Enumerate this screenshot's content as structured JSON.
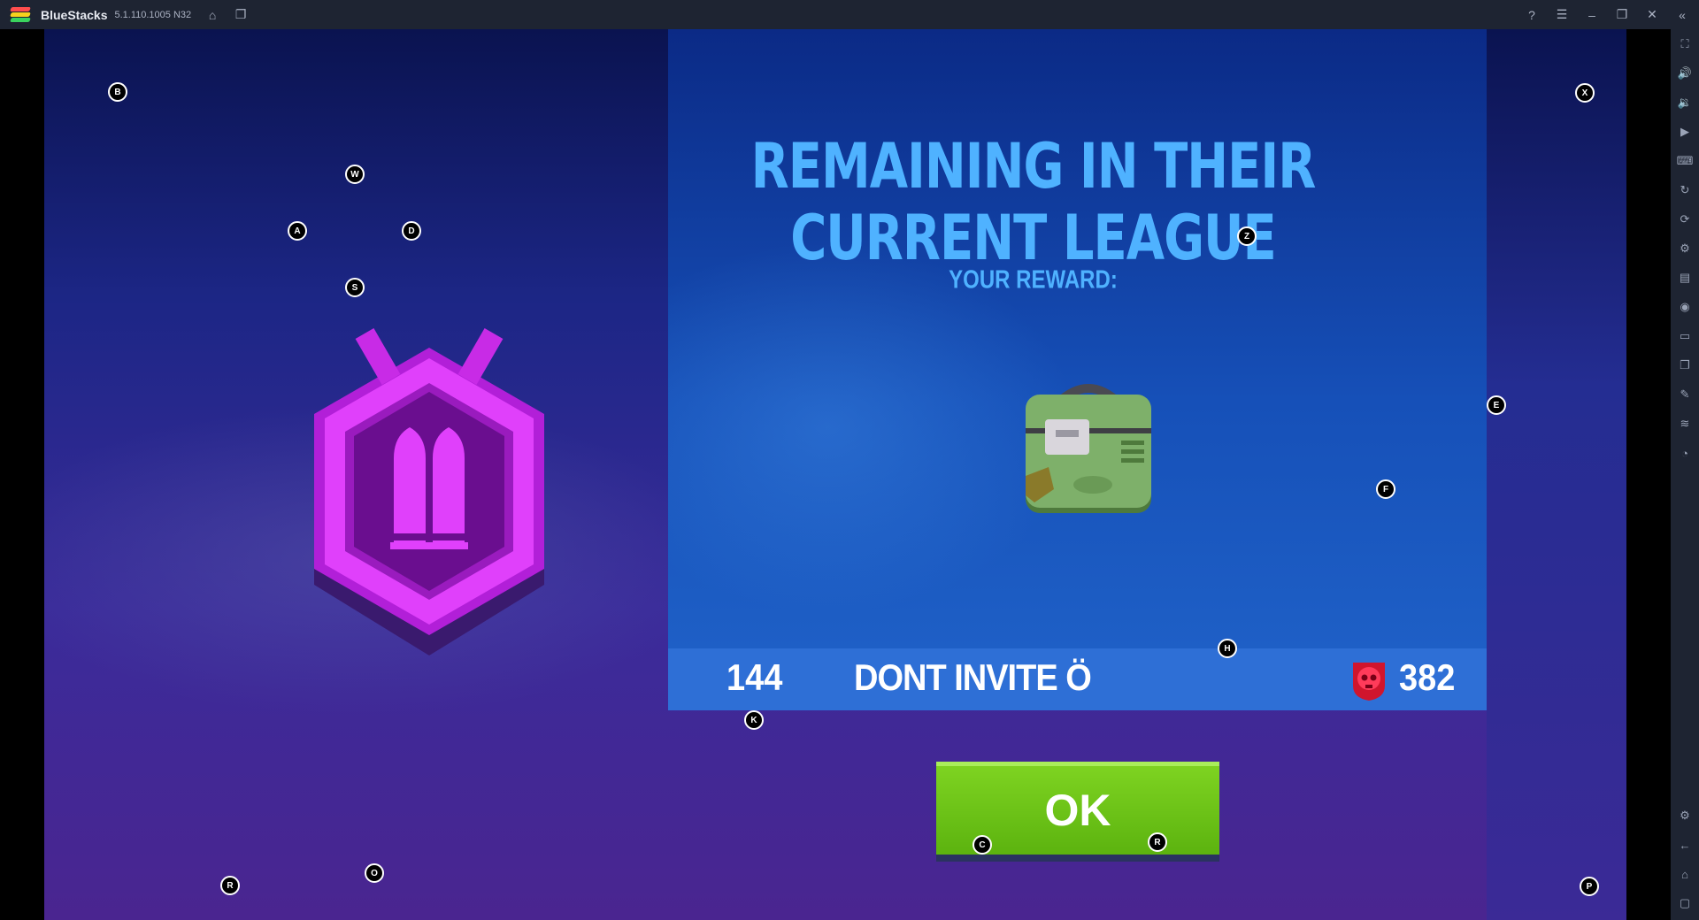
{
  "window": {
    "app_name": "BlueStacks",
    "version": "5.1.110.1005 N32"
  },
  "game": {
    "headline": "REMAINING IN THEIR CURRENT LEAGUE",
    "reward_label": "YOUR REWARD:",
    "player": {
      "rank": "144",
      "name": "DONT INVITE Ö",
      "score": "382"
    },
    "ok_label": "OK"
  },
  "keymap": {
    "B": "B",
    "W": "W",
    "A": "A",
    "D": "D",
    "S": "S",
    "X": "X",
    "Z": "Z",
    "E": "E",
    "F": "F",
    "H": "H",
    "K": "K",
    "C": "C",
    "R": "R",
    "O": "O",
    "P": "P"
  },
  "colors": {
    "titlebar": "#1e2432",
    "headline": "#4fb2ff",
    "ok_button": "#6cc31a",
    "player_bar": "#2e6fd6",
    "badge": "#e040fb"
  }
}
